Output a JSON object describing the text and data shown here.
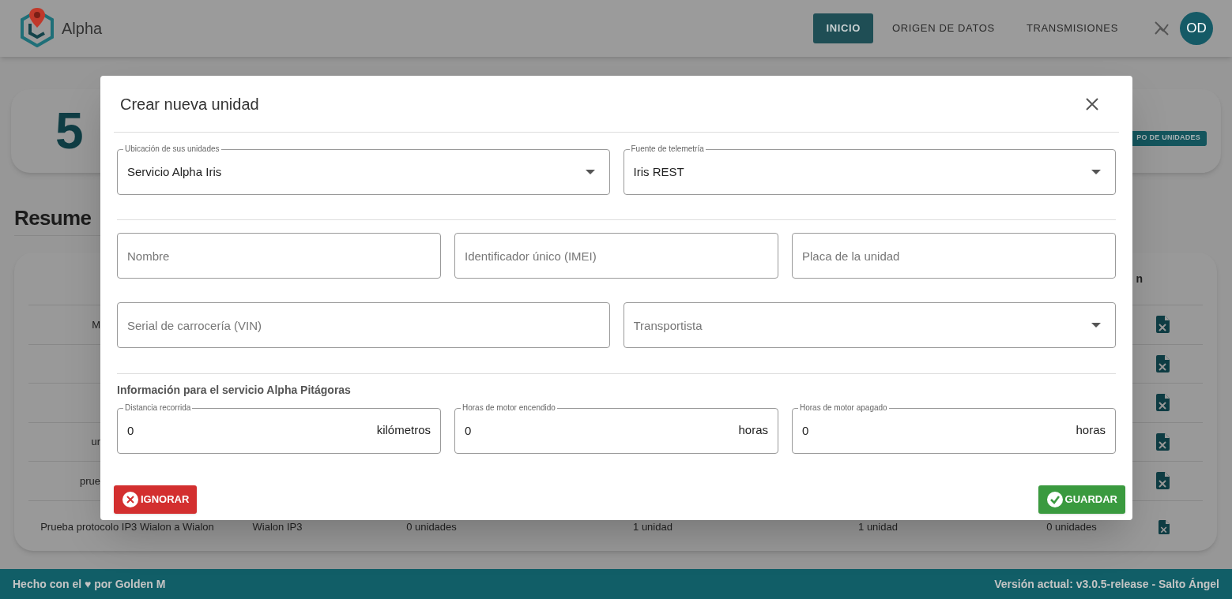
{
  "header": {
    "logo_text": "Alpha",
    "nav": [
      {
        "label": "INICIO",
        "selected": true
      },
      {
        "label": "ORIGEN DE DATOS",
        "selected": false
      },
      {
        "label": "TRANSMISIONES",
        "selected": false
      }
    ],
    "avatar": "OD"
  },
  "background": {
    "stat_value": "5",
    "stat_button": "PO DE UNIDADES",
    "section_title": "Resume",
    "table_header": "n",
    "rows": [
      {
        "cells": [
          "M"
        ]
      },
      {},
      {},
      {
        "cells": [
          "ur"
        ]
      },
      {
        "cells": [
          "prue"
        ]
      },
      {
        "cells": [
          "Prueba protocolo IP3 Wialon a Wialon",
          "Wialon IP3",
          "0 unidades",
          "1 unidad",
          "1 unidad",
          "0 unidades"
        ]
      }
    ]
  },
  "dialog": {
    "title": "Crear nueva unidad",
    "groups": [
      {
        "fields": [
          {
            "kind": "select",
            "label": "Ubicación de sus unidades",
            "value": "Servicio Alpha Iris"
          },
          {
            "kind": "select",
            "label": "Fuente de telemetría",
            "value": "Iris REST"
          }
        ]
      },
      {
        "fields": [
          {
            "kind": "text",
            "placeholder": "Nombre"
          },
          {
            "kind": "text",
            "placeholder": "Identificador único (IMEI)"
          },
          {
            "kind": "text",
            "placeholder": "Placa de la unidad"
          }
        ]
      },
      {
        "fields": [
          {
            "kind": "text",
            "placeholder": "Serial de carrocería (VIN)"
          },
          {
            "kind": "select",
            "placeholder": "Transportista"
          }
        ]
      },
      {
        "title": "Información para el servicio Alpha Pitágoras",
        "fields": [
          {
            "kind": "unit",
            "label": "Distancia recorrida",
            "value": "0",
            "unit": "kilómetros"
          },
          {
            "kind": "unit",
            "label": "Horas de motor encendido",
            "value": "0",
            "unit": "horas"
          },
          {
            "kind": "unit",
            "label": "Horas de motor apagado",
            "value": "0",
            "unit": "horas"
          }
        ]
      }
    ],
    "buttons": [
      {
        "kind": "cancel",
        "label": "IGNORAR"
      },
      {
        "kind": "save",
        "label": "GUARDAR"
      }
    ]
  },
  "footer": {
    "left": "Hecho con el ♥ por Golden M",
    "right": "Versión actual: v3.0.5-release - Salto Ángel"
  }
}
